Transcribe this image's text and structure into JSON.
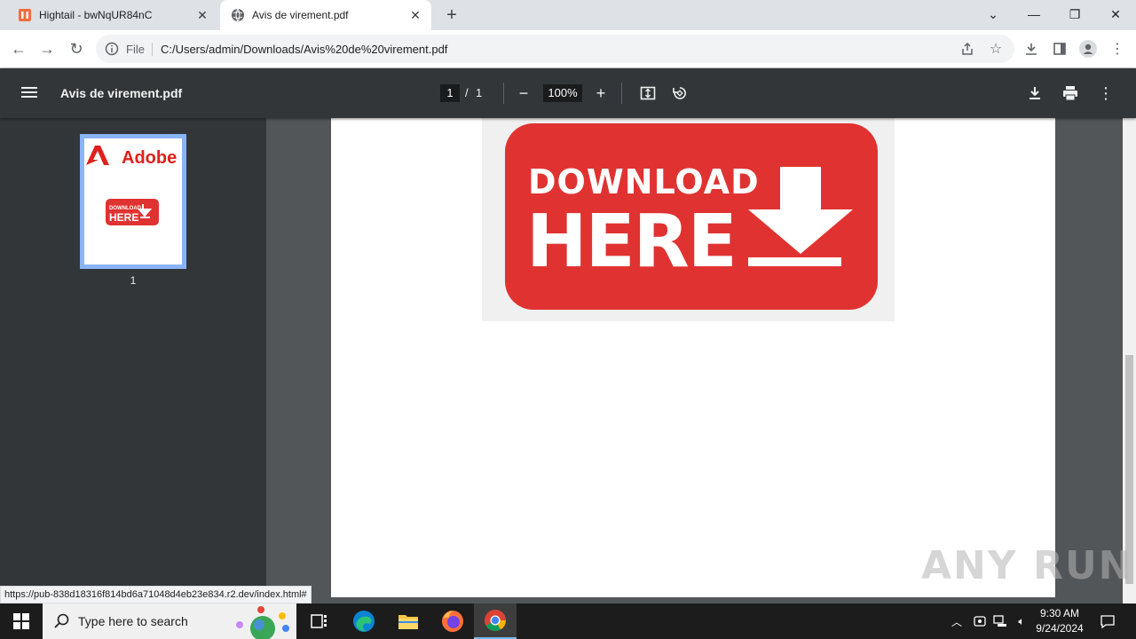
{
  "browser": {
    "tabs": [
      {
        "label": "Hightail - bwNqUR84nC",
        "active": false
      },
      {
        "label": "Avis de virement.pdf",
        "active": true
      }
    ],
    "address": {
      "scheme_label": "File",
      "url": "C:/Users/admin/Downloads/Avis%20de%20virement.pdf"
    },
    "status_url": "https://pub-838d18316f814bd6a71048d4eb23e834.r2.dev/index.html#"
  },
  "pdf": {
    "title": "Avis de virement.pdf",
    "current_page": "1",
    "page_separator": "/",
    "total_pages": "1",
    "zoom": "100%",
    "thumbnail_page_label": "1",
    "thumbnail_brand": "Adobe",
    "content": {
      "line1": "DOWNLOAD",
      "line2": "HERE",
      "accent_color": "#e03331"
    }
  },
  "watermark": "ANY RUN",
  "taskbar": {
    "search_placeholder": "Type here to search",
    "time": "9:30 AM",
    "date": "9/24/2024"
  }
}
